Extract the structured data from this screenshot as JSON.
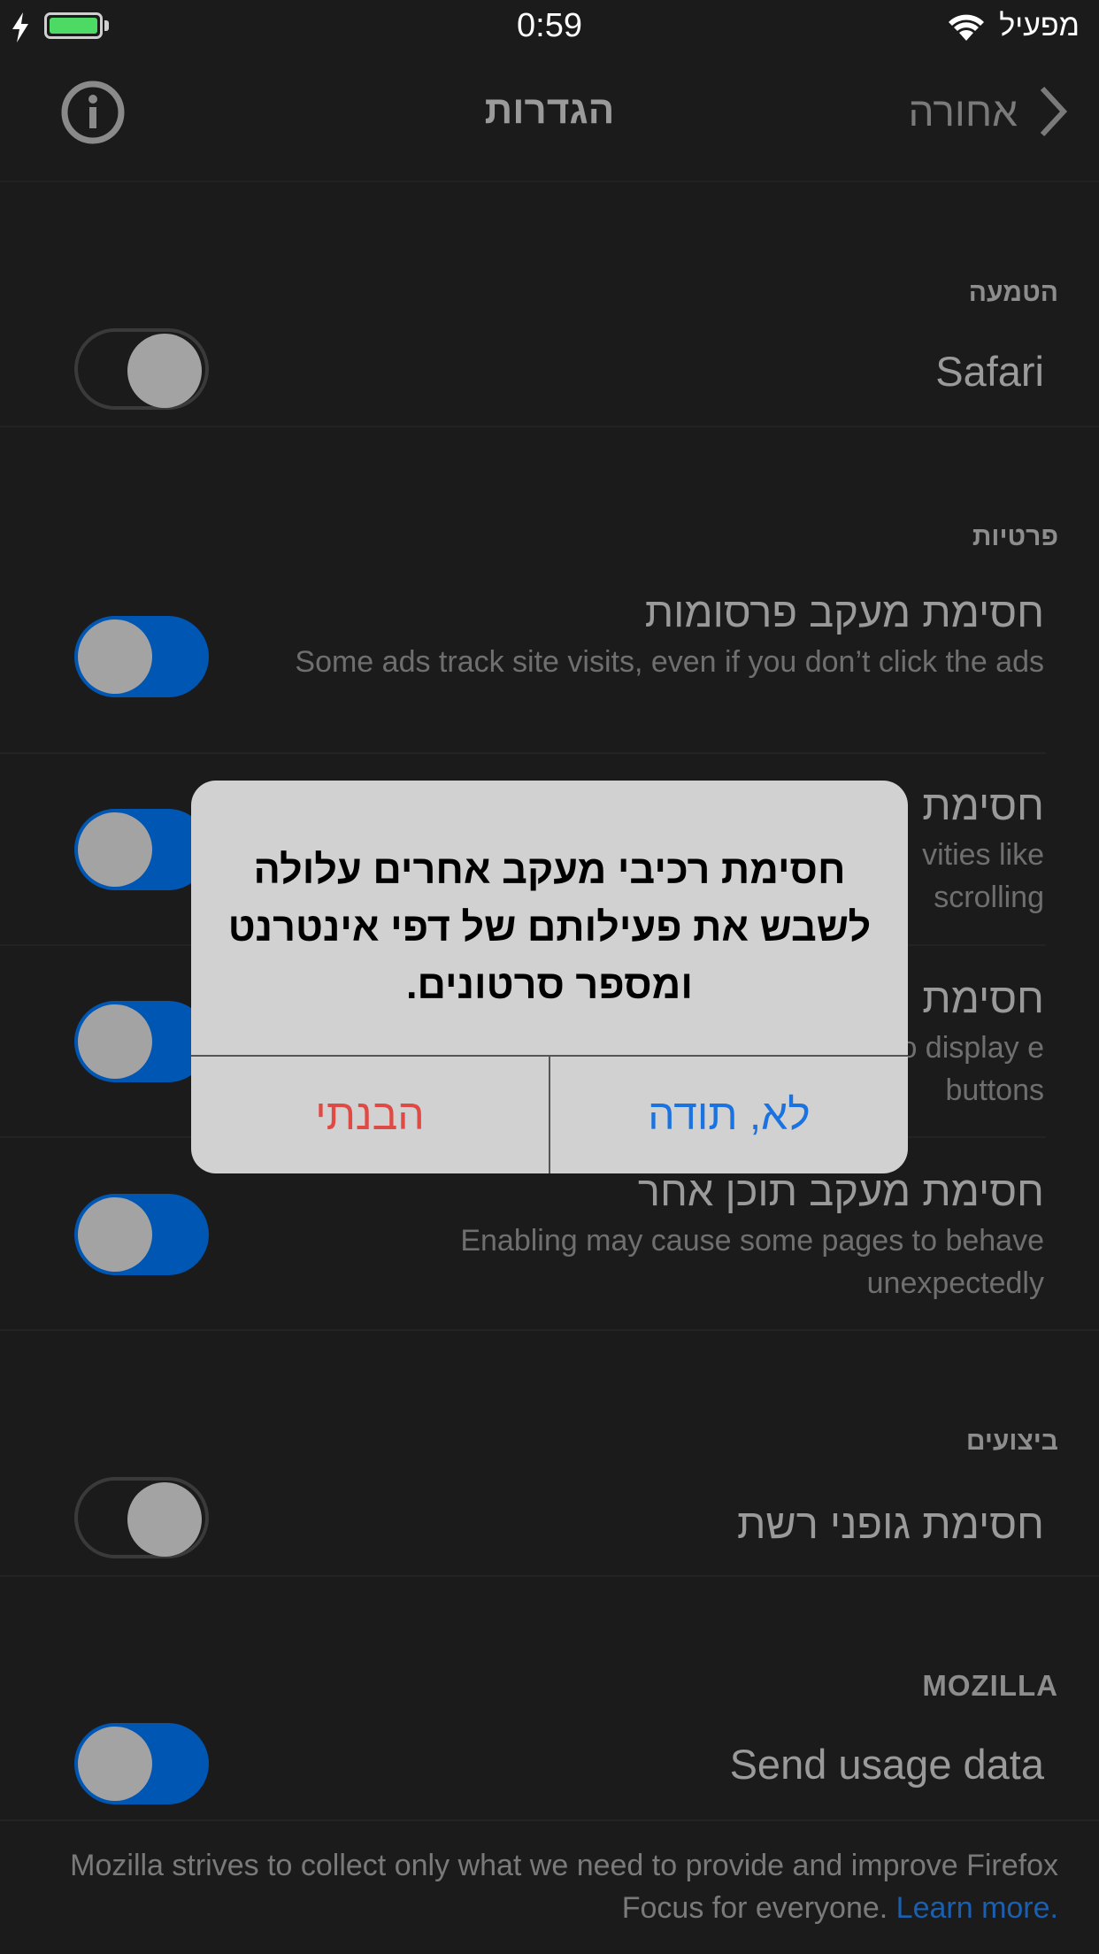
{
  "status_bar": {
    "time": "0:59",
    "carrier": "מפעיל",
    "battery_level": 1.0
  },
  "nav": {
    "title": "הגדרות",
    "back_label": "אחורה",
    "info_icon": "info-icon"
  },
  "integration": {
    "header": "הטמעה",
    "rows": [
      {
        "title": "Safari",
        "toggle": false
      }
    ]
  },
  "privacy": {
    "header": "פרטיות",
    "rows": [
      {
        "title": "חסימת מעקב פרסומות",
        "subtitle": "Some ads track site visits, even if you don’t click the ads",
        "toggle": true
      },
      {
        "title": "חסימת מ",
        "subtitle": "vities like scrolling",
        "toggle": true
      },
      {
        "title": "חסימת מ",
        "subtitle": "to display e buttons",
        "toggle": true
      },
      {
        "title": "חסימת מעקב תוכן אחר",
        "subtitle": "Enabling may cause some pages to behave unexpectedly",
        "toggle": true
      }
    ]
  },
  "performance": {
    "header": "ביצועים",
    "rows": [
      {
        "title": "חסימת גופני רשת",
        "toggle": false
      }
    ]
  },
  "mozilla": {
    "header": "MOZILLA",
    "rows": [
      {
        "title": "Send usage data",
        "toggle": true
      }
    ],
    "footer_text": "Mozilla strives to collect only what we need to provide and improve Firefox Focus for everyone.",
    "footer_link": "Learn more."
  },
  "alert": {
    "message": "חסימת רכיבי מעקב אחרים עלולה לשבש את פעילותם של דפי אינטרנט ומספר סרטונים.",
    "ok_label": "הבנתי",
    "no_label": "לא, תודה"
  },
  "colors": {
    "background": "#1b1b1b",
    "toggle_on": "#0056b3",
    "alert_bg": "#d1d1d1",
    "alert_ok": "#e04a45",
    "alert_no": "#1a73e0",
    "link": "#1a5fb0"
  }
}
